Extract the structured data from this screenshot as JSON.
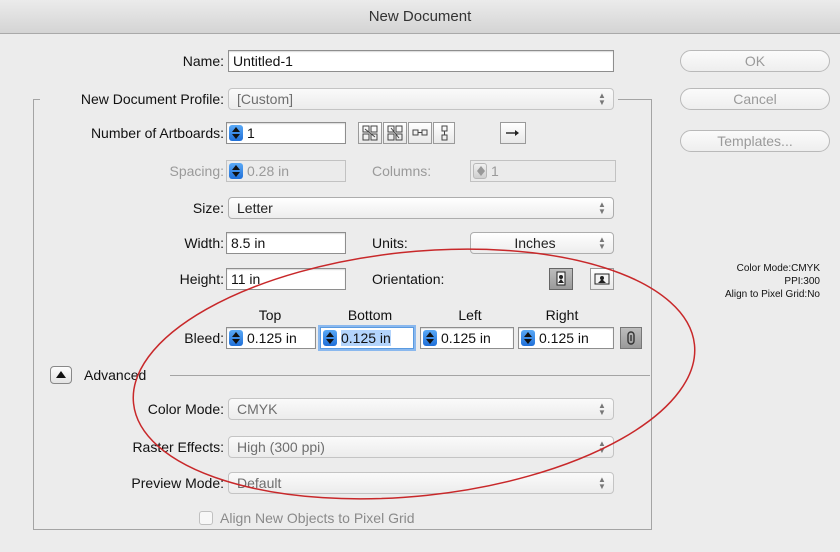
{
  "window": {
    "title": "New Document"
  },
  "buttons": {
    "ok": "OK",
    "cancel": "Cancel",
    "templates": "Templates..."
  },
  "labels": {
    "name": "Name:",
    "profile": "New Document Profile:",
    "artboards": "Number of Artboards:",
    "spacing": "Spacing:",
    "columns": "Columns:",
    "size": "Size:",
    "width": "Width:",
    "units": "Units:",
    "height": "Height:",
    "orientation": "Orientation:",
    "bleed": "Bleed:",
    "bleed_top": "Top",
    "bleed_bottom": "Bottom",
    "bleed_left": "Left",
    "bleed_right": "Right",
    "advanced": "Advanced",
    "color_mode": "Color Mode:",
    "raster_effects": "Raster Effects:",
    "preview_mode": "Preview Mode:",
    "align_pixel_grid": "Align New Objects to Pixel Grid"
  },
  "values": {
    "name": "Untitled-1",
    "profile": "[Custom]",
    "artboards": "1",
    "spacing": "0.28 in",
    "columns": "1",
    "size": "Letter",
    "width": "8.5 in",
    "units": "Inches",
    "height": "11 in",
    "bleed_top": "0.125 in",
    "bleed_bottom": "0.125 in",
    "bleed_left": "0.125 in",
    "bleed_right": "0.125 in",
    "color_mode": "CMYK",
    "raster_effects": "High (300 ppi)",
    "preview_mode": "Default",
    "align_pixel_grid_checked": false
  },
  "info": {
    "color_mode": "Color Mode:CMYK",
    "ppi": "PPI:300",
    "align": "Align to Pixel Grid:No"
  },
  "annotation_color": "#c8282a",
  "accent_color": "#2f86ea"
}
